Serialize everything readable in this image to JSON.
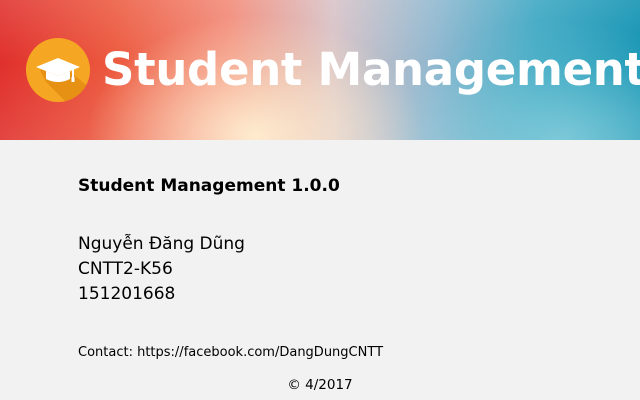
{
  "banner": {
    "app_name": "Student Management",
    "logo_icon": "graduation-cap-icon"
  },
  "about": {
    "version_title": "Student Management 1.0.0",
    "author_name": "Nguyễn Đăng Dũng",
    "class_name": "CNTT2-K56",
    "student_id": "151201668",
    "contact": "Contact: https://facebook.com/DangDungCNTT",
    "copyright": "© 4/2017"
  },
  "colors": {
    "logo_circle": "#f5a623",
    "logo_shadow": "#e0890f",
    "banner_left": "#e0302c",
    "banner_right": "#1092b2",
    "background": "#f2f2f2"
  }
}
